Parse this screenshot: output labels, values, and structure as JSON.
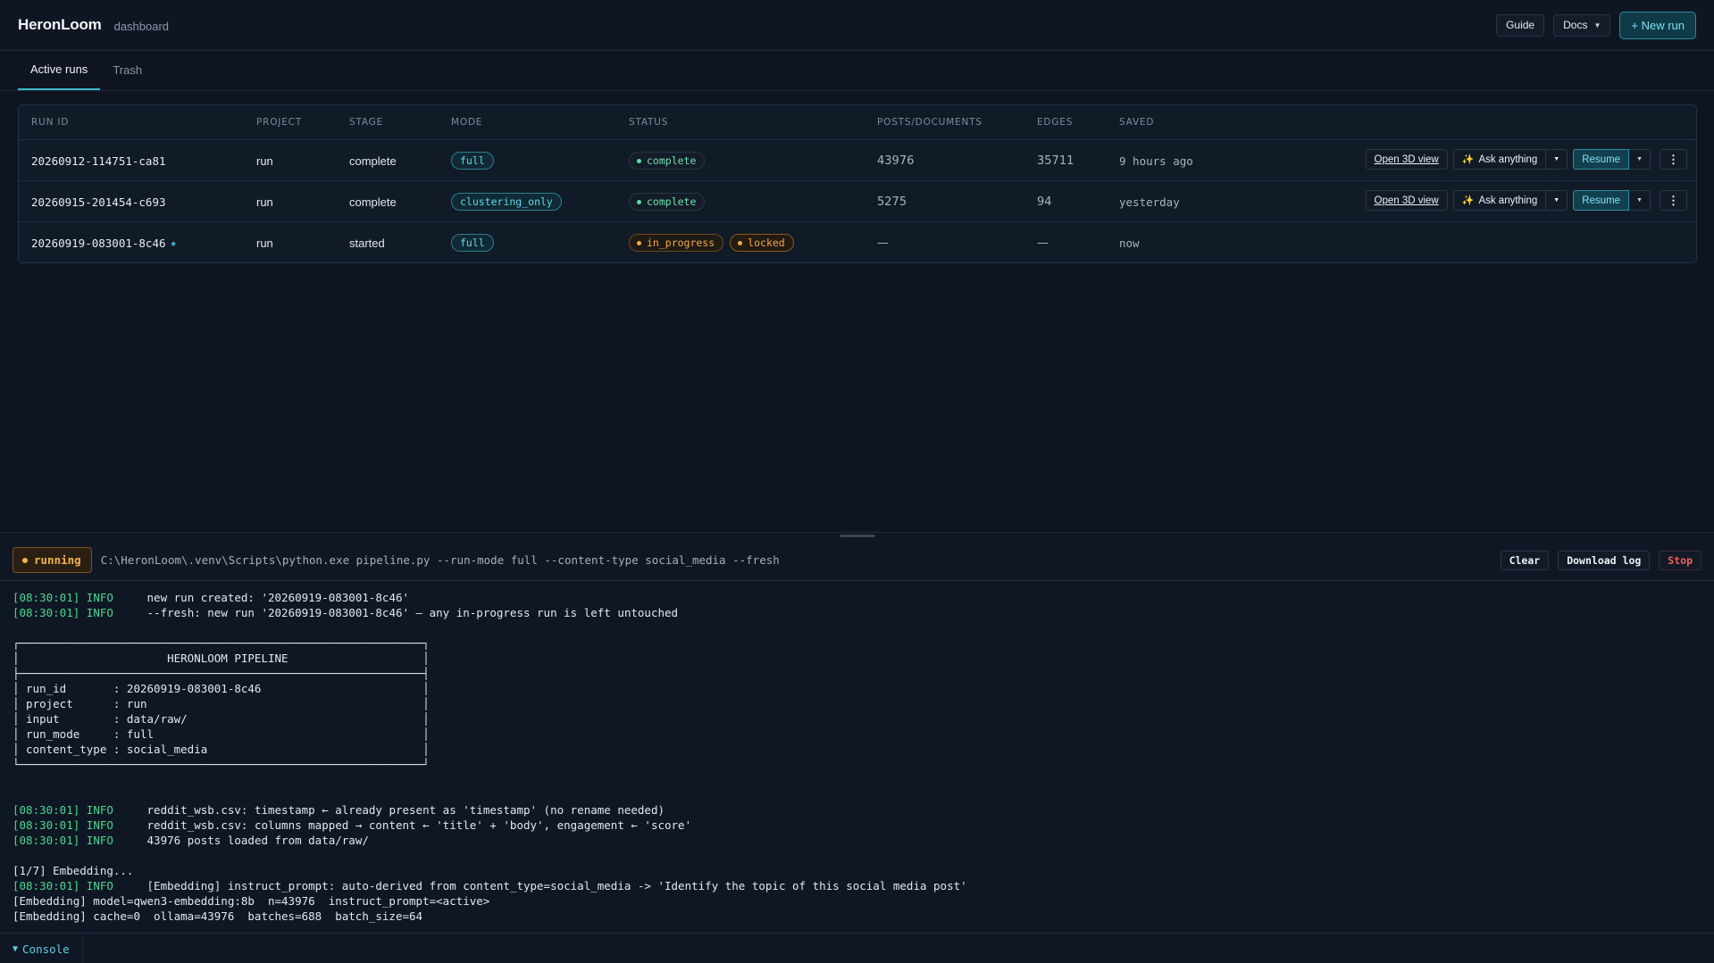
{
  "header": {
    "brand": "HeronLoom",
    "subtitle": "dashboard",
    "guide_label": "Guide",
    "docs_label": "Docs",
    "new_run_label": "+ New run"
  },
  "tabs": [
    {
      "label": "Active runs",
      "active": true
    },
    {
      "label": "Trash",
      "active": false
    }
  ],
  "table": {
    "columns": [
      "RUN ID",
      "PROJECT",
      "STAGE",
      "MODE",
      "STATUS",
      "POSTS/DOCUMENTS",
      "EDGES",
      "SAVED"
    ],
    "rows": [
      {
        "run_id": "20260912-114751-ca81",
        "project": "run",
        "stage": "complete",
        "mode": "full",
        "status": "complete",
        "posts": "43976",
        "edges": "35711",
        "saved": "9 hours ago",
        "actions": true
      },
      {
        "run_id": "20260915-201454-c693",
        "project": "run",
        "stage": "complete",
        "mode": "clustering_only",
        "status": "complete",
        "posts": "5275",
        "edges": "94",
        "saved": "yesterday",
        "actions": true
      },
      {
        "run_id": "20260919-083001-8c46",
        "starred": true,
        "project": "run",
        "stage": "started",
        "mode": "full",
        "status": "in_progress",
        "extra_status": "locked",
        "posts": "—",
        "edges": "—",
        "saved": "now",
        "actions": false
      }
    ],
    "action_labels": {
      "open_3d": "Open 3D view",
      "ask": "Ask anything",
      "resume": "Resume"
    }
  },
  "console": {
    "state_label": "running",
    "command": "C:\\HeronLoom\\.venv\\Scripts\\python.exe pipeline.py --run-mode full --content-type social_media --fresh",
    "clear_label": "Clear",
    "download_label": "Download log",
    "stop_label": "Stop",
    "toggle_label": "Console",
    "log": [
      {
        "ts": "[08:30:01]",
        "lvl": "INFO",
        "msg": "new run created: '20260919-083001-8c46'"
      },
      {
        "ts": "[08:30:01]",
        "lvl": "INFO",
        "msg": "--fresh: new run '20260919-083001-8c46' — any in-progress run is left untouched"
      },
      {
        "gap": true
      },
      {
        "text": "┌────────────────────────────────────────────────────────────┐"
      },
      {
        "text": "│                      HERONLOOM PIPELINE                    │"
      },
      {
        "text": "├────────────────────────────────────────────────────────────┤"
      },
      {
        "text": "│ run_id       : 20260919-083001-8c46                        │"
      },
      {
        "text": "│ project      : run                                         │"
      },
      {
        "text": "│ input        : data/raw/                                   │"
      },
      {
        "text": "│ run_mode     : full                                        │"
      },
      {
        "text": "│ content_type : social_media                                │"
      },
      {
        "text": "└────────────────────────────────────────────────────────────┘"
      },
      {
        "gap": true
      },
      {
        "gap": true
      },
      {
        "ts": "[08:30:01]",
        "lvl": "INFO",
        "msg": "reddit_wsb.csv: timestamp ← already present as 'timestamp' (no rename needed)"
      },
      {
        "ts": "[08:30:01]",
        "lvl": "INFO",
        "msg": "reddit_wsb.csv: columns mapped → content ← 'title' + 'body', engagement ← 'score'"
      },
      {
        "ts": "[08:30:01]",
        "lvl": "INFO",
        "msg": "43976 posts loaded from data/raw/"
      },
      {
        "gap": true
      },
      {
        "text": "[1/7] Embedding..."
      },
      {
        "ts": "[08:30:01]",
        "lvl": "INFO",
        "msg": "[Embedding] instruct_prompt: auto-derived from content_type=social_media -> 'Identify the topic of this social media post'"
      },
      {
        "text": "[Embedding] model=qwen3-embedding:8b  n=43976  instruct_prompt=<active>"
      },
      {
        "text": "[Embedding] cache=0  ollama=43976  batches=688  batch_size=64"
      }
    ]
  }
}
